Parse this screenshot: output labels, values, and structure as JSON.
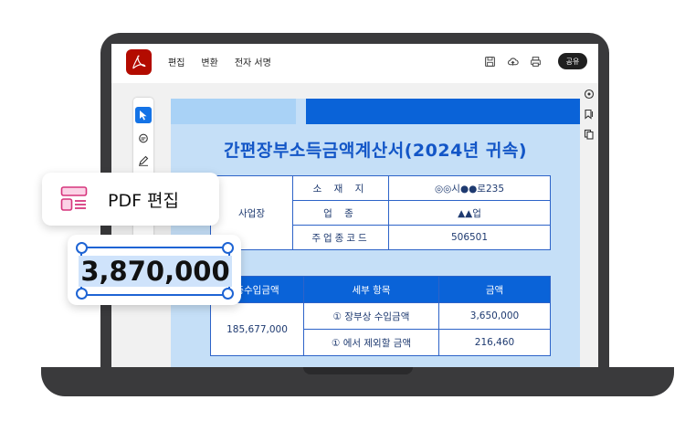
{
  "toolbar": {
    "menu": [
      "편집",
      "변환",
      "전자 서명"
    ],
    "share_label": "공유"
  },
  "document": {
    "title": "간편장부소득금액계산서(2024년 귀속)",
    "info_table": {
      "section_label": "사업장",
      "rows": [
        {
          "field": "소 재 지",
          "value": "◎◎시●●로235"
        },
        {
          "field": "업  종",
          "value": "▲▲업"
        },
        {
          "field": "주업종코드",
          "value": "506501"
        }
      ]
    },
    "income_table": {
      "headers": [
        "총수입금액",
        "세부 항목",
        "금액"
      ],
      "total": "185,677,000",
      "rows": [
        {
          "item": "① 장부상 수입금액",
          "amount": "3,650,000"
        },
        {
          "item": "① 에서 제외할 금액",
          "amount": "216,460"
        }
      ]
    }
  },
  "cards": {
    "pdf_edit_label": "PDF 편집",
    "selected_number": "3,870,000"
  },
  "colors": {
    "accent": "#1e64d4",
    "brand": "#b30b00",
    "doc_bg": "#c5dff7",
    "header_blue": "#0a63d8"
  }
}
